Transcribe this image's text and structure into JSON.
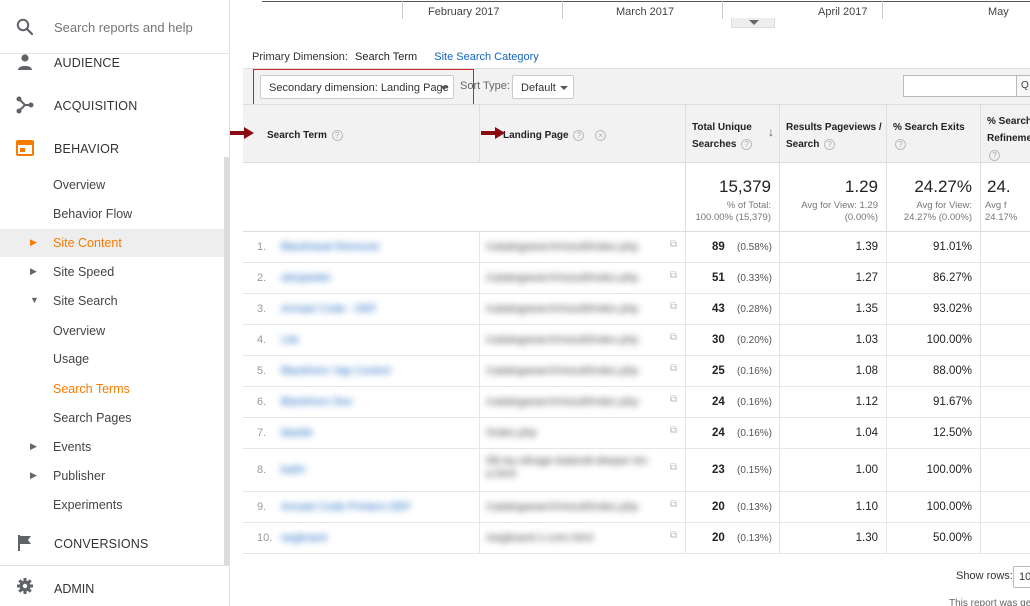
{
  "sidebar": {
    "search_placeholder": "Search reports and help",
    "sections": {
      "audience": "AUDIENCE",
      "acquisition": "ACQUISITION",
      "behavior": "BEHAVIOR",
      "conversions": "CONVERSIONS",
      "admin": "ADMIN"
    },
    "behavior_items": {
      "overview": "Overview",
      "behavior_flow": "Behavior Flow",
      "site_content": "Site Content",
      "site_speed": "Site Speed",
      "site_search": "Site Search",
      "ss_overview": "Overview",
      "usage": "Usage",
      "search_terms": "Search Terms",
      "search_pages": "Search Pages",
      "events": "Events",
      "publisher": "Publisher",
      "experiments": "Experiments"
    },
    "accent_color": "#f57c00"
  },
  "timeline": {
    "months": [
      "February 2017",
      "March 2017",
      "April 2017",
      "May"
    ]
  },
  "dimension": {
    "label": "Primary Dimension:",
    "primary": "Search Term",
    "alternate": "Site Search Category"
  },
  "toolbar": {
    "secondary_dimension": "Secondary dimension: Landing Page",
    "sort_label": "Sort Type:",
    "sort_value": "Default",
    "search_button": "Q"
  },
  "table": {
    "headers": {
      "search_term": "Search Term",
      "landing_page": "Landing Page",
      "total_unique_line1": "Total Unique",
      "total_unique_line2": "Searches",
      "results_pv_line1": "Results Pageviews /",
      "results_pv_line2": "Search",
      "search_exits": "% Search Exits",
      "search_refine_line1": "% Search",
      "search_refine_line2": "Refineme"
    },
    "totals": {
      "searches": "15,379",
      "searches_sub1": "% of Total:",
      "searches_sub2": "100.00% (15,379)",
      "pv": "1.29",
      "pv_sub1": "Avg for View: 1.29",
      "pv_sub2": "(0.00%)",
      "exits": "24.27%",
      "exits_sub1": "Avg for View:",
      "exits_sub2": "24.27% (0.00%)",
      "refine": "24.",
      "refine_sub1": "Avg f",
      "refine_sub2": "24.17%"
    },
    "rows": [
      {
        "idx": "1.",
        "term": "Blackhead Remover",
        "page": "/catalogsearch/result/index.php",
        "searches": "89",
        "pct": "(0.58%)",
        "pv": "1.39",
        "exits": "91.01%"
      },
      {
        "idx": "2.",
        "term": "skinpeeler",
        "page": "/catalogsearch/result/index.php",
        "searches": "51",
        "pct": "(0.33%)",
        "pv": "1.27",
        "exits": "86.27%"
      },
      {
        "idx": "3.",
        "term": "Annaet Code - DEF",
        "page": "/catalogsearch/result/index.php",
        "searches": "43",
        "pct": "(0.28%)",
        "pv": "1.35",
        "exits": "93.02%"
      },
      {
        "idx": "4.",
        "term": "Lite",
        "page": "/catalogsearch/result/index.php",
        "searches": "30",
        "pct": "(0.20%)",
        "pv": "1.03",
        "exits": "100.00%"
      },
      {
        "idx": "5.",
        "term": "Blackhorn Vap Control",
        "page": "/catalogsearch/result/index.php",
        "searches": "25",
        "pct": "(0.16%)",
        "pv": "1.08",
        "exits": "88.00%"
      },
      {
        "idx": "6.",
        "term": "Blackhorn Dev",
        "page": "/catalogsearch/result/index.php",
        "searches": "24",
        "pct": "(0.16%)",
        "pv": "1.12",
        "exits": "91.67%"
      },
      {
        "idx": "7.",
        "term": "blastle",
        "page": "/index.php",
        "searches": "24",
        "pct": "(0.16%)",
        "pv": "1.04",
        "exits": "12.50%"
      },
      {
        "idx": "8.",
        "term": "bathi",
        "page": "/lib-by-ultrage-balandt-deeper-lot-a.html",
        "searches": "23",
        "pct": "(0.15%)",
        "pv": "1.00",
        "exits": "100.00%"
      },
      {
        "idx": "9.",
        "term": "Annaet Code Printers DEF",
        "page": "/catalogsearch/result/index.php",
        "searches": "20",
        "pct": "(0.13%)",
        "pv": "1.10",
        "exits": "100.00%"
      },
      {
        "idx": "10.",
        "term": "segboard",
        "page": "/segboard-1-com.html",
        "searches": "20",
        "pct": "(0.13%)",
        "pv": "1.30",
        "exits": "50.00%"
      }
    ]
  },
  "footer": {
    "show_rows_label": "Show rows:",
    "show_rows_value": "10",
    "note": "This report was ge"
  }
}
